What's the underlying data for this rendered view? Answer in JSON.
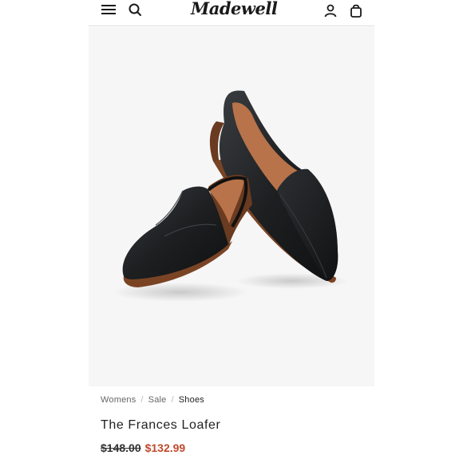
{
  "header": {
    "logo": "Madewell",
    "icons": [
      "menu-icon",
      "search-icon",
      "account-icon",
      "bag-icon"
    ]
  },
  "product": {
    "image": "black-leather-loafers",
    "breadcrumb": [
      "Womens",
      "Sale",
      "Shoes"
    ],
    "breadcrumb_separator": "/",
    "title": "The Frances Loafer",
    "original_price": "$148.00",
    "sale_price": "$132.99"
  },
  "colors": {
    "sale": "#c0492d",
    "text": "#222222",
    "image_bg": "#f6f6f6"
  }
}
